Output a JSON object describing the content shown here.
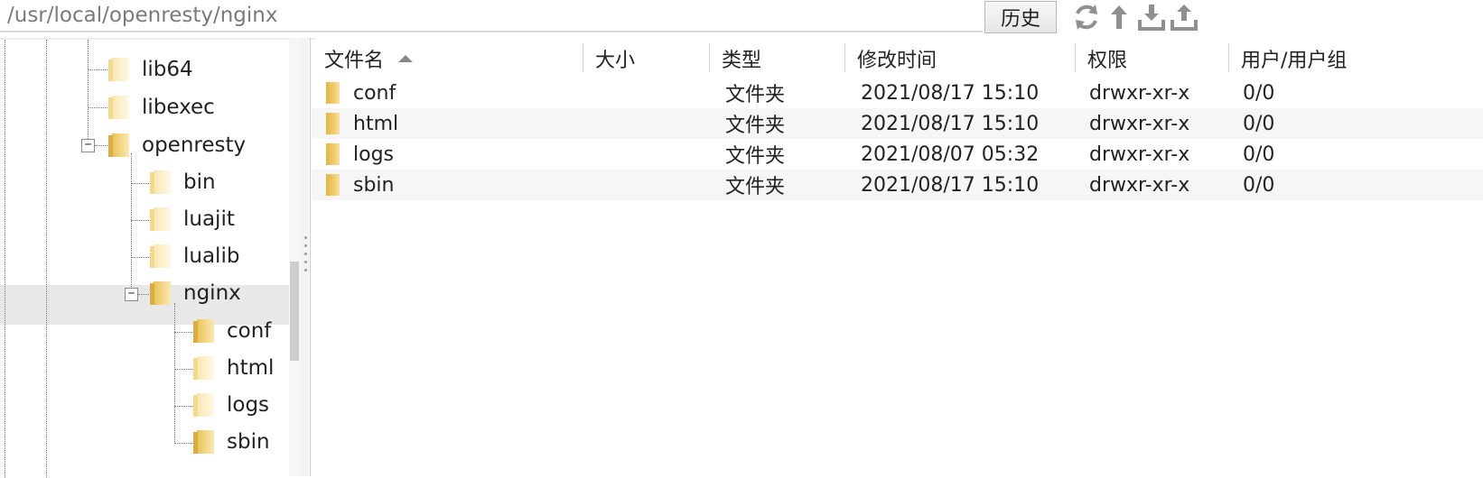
{
  "path_bar": {
    "path": "/usr/local/openresty/nginx",
    "history_label": "历史",
    "tools": [
      {
        "icon": "refresh-icon"
      },
      {
        "icon": "up-arrow-icon"
      },
      {
        "icon": "download-icon"
      },
      {
        "icon": "upload-icon"
      }
    ]
  },
  "tree": {
    "nodes": [
      {
        "label": "lib64"
      },
      {
        "label": "libexec"
      },
      {
        "label": "openresty"
      },
      {
        "label": "bin"
      },
      {
        "label": "luajit"
      },
      {
        "label": "lualib"
      },
      {
        "label": "nginx"
      },
      {
        "label": "conf"
      },
      {
        "label": "html"
      },
      {
        "label": "logs"
      },
      {
        "label": "sbin"
      }
    ],
    "expanded_symbol": "−"
  },
  "file_table": {
    "columns": [
      {
        "label": "文件名"
      },
      {
        "label": "大小"
      },
      {
        "label": "类型"
      },
      {
        "label": "修改时间"
      },
      {
        "label": "权限"
      },
      {
        "label": "用户/用户组"
      }
    ],
    "rows": [
      {
        "name": "conf",
        "size": "",
        "type": "文件夹",
        "modified": "2021/08/17 15:10",
        "permissions": "drwxr-xr-x",
        "owner": "0/0"
      },
      {
        "name": "html",
        "size": "",
        "type": "文件夹",
        "modified": "2021/08/17 15:10",
        "permissions": "drwxr-xr-x",
        "owner": "0/0"
      },
      {
        "name": "logs",
        "size": "",
        "type": "文件夹",
        "modified": "2021/08/07 05:32",
        "permissions": "drwxr-xr-x",
        "owner": "0/0"
      },
      {
        "name": "sbin",
        "size": "",
        "type": "文件夹",
        "modified": "2021/08/17 15:10",
        "permissions": "drwxr-xr-x",
        "owner": "0/0"
      }
    ]
  },
  "colors": {
    "folder": "#f0cd6c",
    "selection": "#e8e8e8"
  }
}
